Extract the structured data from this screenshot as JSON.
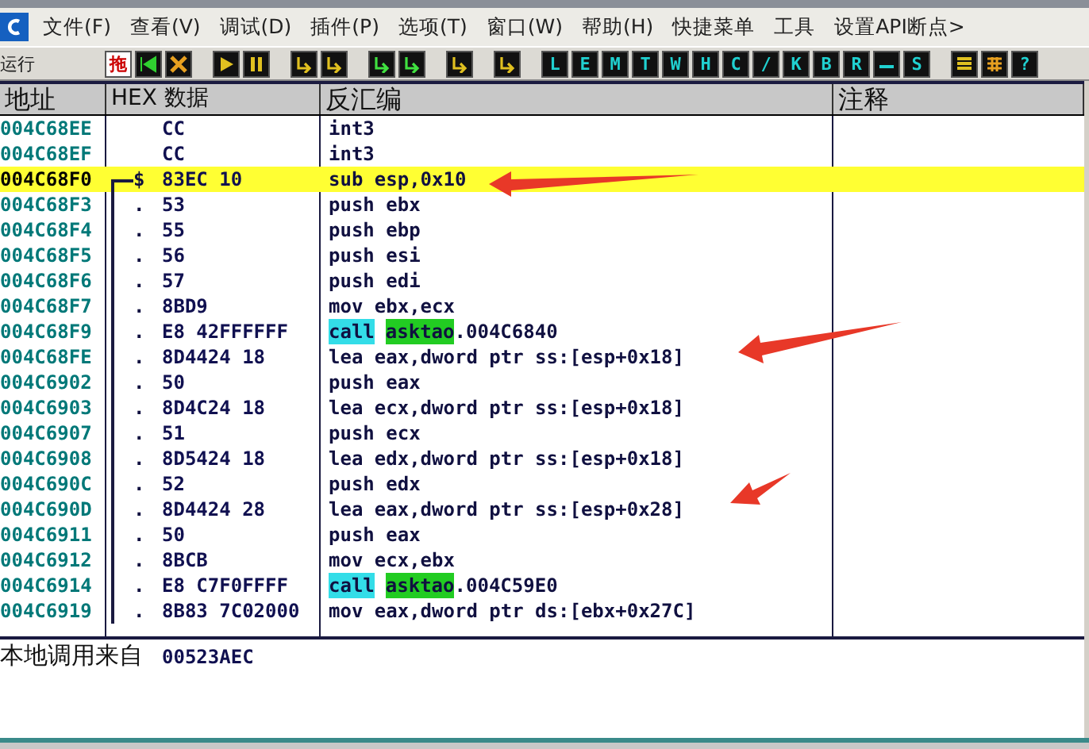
{
  "menu_bar": {
    "items": [
      "文件(F)",
      "查看(V)",
      "调试(D)",
      "插件(P)",
      "选项(T)",
      "窗口(W)",
      "帮助(H)",
      "快捷菜单",
      "工具",
      "设置API断点>"
    ]
  },
  "toolbar": {
    "status": "运行",
    "buttons": [
      {
        "kind": "text",
        "label": "拖"
      },
      {
        "kind": "icon"
      },
      {
        "kind": "icon"
      },
      {
        "kind": "gap"
      },
      {
        "kind": "icon"
      },
      {
        "kind": "icon"
      },
      {
        "kind": "gap"
      },
      {
        "kind": "icon"
      },
      {
        "kind": "icon"
      },
      {
        "kind": "gap"
      },
      {
        "kind": "icon"
      },
      {
        "kind": "icon"
      },
      {
        "kind": "gap"
      },
      {
        "kind": "icon"
      },
      {
        "kind": "gap"
      },
      {
        "kind": "icon"
      },
      {
        "kind": "gap"
      },
      {
        "kind": "letter",
        "label": "L"
      },
      {
        "kind": "letter",
        "label": "E"
      },
      {
        "kind": "letter",
        "label": "M"
      },
      {
        "kind": "letter",
        "label": "T"
      },
      {
        "kind": "letter",
        "label": "W"
      },
      {
        "kind": "letter",
        "label": "H"
      },
      {
        "kind": "letter",
        "label": "C"
      },
      {
        "kind": "letter",
        "label": "/"
      },
      {
        "kind": "letter",
        "label": "K"
      },
      {
        "kind": "letter",
        "label": "B"
      },
      {
        "kind": "letter",
        "label": "R"
      },
      {
        "kind": "icon"
      },
      {
        "kind": "letter",
        "label": "S"
      },
      {
        "kind": "gap"
      },
      {
        "kind": "icon"
      },
      {
        "kind": "icon"
      },
      {
        "kind": "letter",
        "label": "?"
      }
    ]
  },
  "table": {
    "columns": [
      "地址",
      "HEX 数据",
      "反汇编",
      "注释"
    ],
    "rows": [
      {
        "address": "004C68EE",
        "procedure_start": false,
        "in_procedure": false,
        "marker": "",
        "hex": "CC",
        "kind": "plain",
        "code": "int3",
        "selected": false
      },
      {
        "address": "004C68EF",
        "procedure_start": false,
        "in_procedure": false,
        "marker": "",
        "hex": "CC",
        "kind": "plain",
        "code": "int3",
        "selected": false
      },
      {
        "address": "004C68F0",
        "procedure_start": true,
        "in_procedure": false,
        "marker": "$",
        "hex": "83EC 10",
        "kind": "plain",
        "code": "sub esp,0x10",
        "selected": true
      },
      {
        "address": "004C68F3",
        "procedure_start": false,
        "in_procedure": true,
        "marker": ".",
        "hex": "53",
        "kind": "plain",
        "code": "push ebx",
        "selected": false
      },
      {
        "address": "004C68F4",
        "procedure_start": false,
        "in_procedure": true,
        "marker": ".",
        "hex": "55",
        "kind": "plain",
        "code": "push ebp",
        "selected": false
      },
      {
        "address": "004C68F5",
        "procedure_start": false,
        "in_procedure": true,
        "marker": ".",
        "hex": "56",
        "kind": "plain",
        "code": "push esi",
        "selected": false
      },
      {
        "address": "004C68F6",
        "procedure_start": false,
        "in_procedure": true,
        "marker": ".",
        "hex": "57",
        "kind": "plain",
        "code": "push edi",
        "selected": false
      },
      {
        "address": "004C68F7",
        "procedure_start": false,
        "in_procedure": true,
        "marker": ".",
        "hex": "8BD9",
        "kind": "plain",
        "code": "mov ebx,ecx",
        "selected": false
      },
      {
        "address": "004C68F9",
        "procedure_start": false,
        "in_procedure": true,
        "marker": ".",
        "hex": "E8 42FFFFFF",
        "kind": "call",
        "code": "call",
        "target": "asktao",
        "suffix": ".004C6840",
        "selected": false
      },
      {
        "address": "004C68FE",
        "procedure_start": false,
        "in_procedure": true,
        "marker": ".",
        "hex": "8D4424 18",
        "kind": "plain",
        "code": "lea eax,dword ptr ss:[esp+0x18]",
        "selected": false
      },
      {
        "address": "004C6902",
        "procedure_start": false,
        "in_procedure": true,
        "marker": ".",
        "hex": "50",
        "kind": "plain",
        "code": "push eax",
        "selected": false
      },
      {
        "address": "004C6903",
        "procedure_start": false,
        "in_procedure": true,
        "marker": ".",
        "hex": "8D4C24 18",
        "kind": "plain",
        "code": "lea ecx,dword ptr ss:[esp+0x18]",
        "selected": false
      },
      {
        "address": "004C6907",
        "procedure_start": false,
        "in_procedure": true,
        "marker": ".",
        "hex": "51",
        "kind": "plain",
        "code": "push ecx",
        "selected": false
      },
      {
        "address": "004C6908",
        "procedure_start": false,
        "in_procedure": true,
        "marker": ".",
        "hex": "8D5424 18",
        "kind": "plain",
        "code": "lea edx,dword ptr ss:[esp+0x18]",
        "selected": false
      },
      {
        "address": "004C690C",
        "procedure_start": false,
        "in_procedure": true,
        "marker": ".",
        "hex": "52",
        "kind": "plain",
        "code": "push edx",
        "selected": false
      },
      {
        "address": "004C690D",
        "procedure_start": false,
        "in_procedure": true,
        "marker": ".",
        "hex": "8D4424 28",
        "kind": "plain",
        "code": "lea eax,dword ptr ss:[esp+0x28]",
        "selected": false
      },
      {
        "address": "004C6911",
        "procedure_start": false,
        "in_procedure": true,
        "marker": ".",
        "hex": "50",
        "kind": "plain",
        "code": "push eax",
        "selected": false
      },
      {
        "address": "004C6912",
        "procedure_start": false,
        "in_procedure": true,
        "marker": ".",
        "hex": "8BCB",
        "kind": "plain",
        "code": "mov ecx,ebx",
        "selected": false
      },
      {
        "address": "004C6914",
        "procedure_start": false,
        "in_procedure": true,
        "marker": ".",
        "hex": "E8 C7F0FFFF",
        "kind": "call",
        "code": "call",
        "target": "asktao",
        "suffix": ".004C59E0",
        "selected": false
      },
      {
        "address": "004C6919",
        "procedure_start": false,
        "in_procedure": true,
        "marker": ".",
        "hex": "8B83 7C02000",
        "kind": "plain",
        "code": "mov eax,dword ptr ds:[ebx+0x27C]",
        "selected": false
      }
    ]
  },
  "info_pane": {
    "label": "本地调用来自",
    "value": "00523AEC"
  }
}
